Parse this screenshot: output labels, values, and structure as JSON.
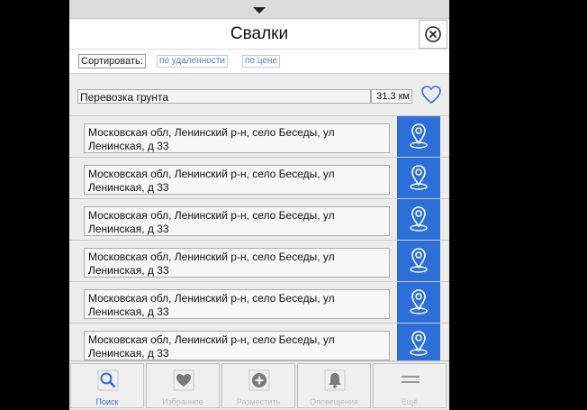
{
  "header": {
    "title": "Свалки"
  },
  "sort": {
    "label": "Сортировать:",
    "by_distance": "по удаленности",
    "by_price": "по цене"
  },
  "service": {
    "name": "Перевозка грунта",
    "distance": "31.3 км"
  },
  "dumps": [
    {
      "address": "Московская обл, Ленинский р-н, село Беседы, ул Ленинская, д 33"
    },
    {
      "address": "Московская обл, Ленинский р-н, село Беседы, ул Ленинская, д 33"
    },
    {
      "address": "Московская обл, Ленинский р-н, село Беседы, ул Ленинская, д 33"
    },
    {
      "address": "Московская обл, Ленинский р-н, село Беседы, ул Ленинская, д 33"
    },
    {
      "address": "Московская обл, Ленинский р-н, село Беседы, ул Ленинская, д 33"
    },
    {
      "address": "Московская обл, Ленинский р-н, село Беседы, ул Ленинская, д 33"
    }
  ],
  "nav": [
    {
      "label": "Поиск",
      "icon": "search-icon",
      "active": true
    },
    {
      "label": "Избранное",
      "icon": "heart-icon",
      "active": false
    },
    {
      "label": "Разместить",
      "icon": "plus-circle-icon",
      "active": false
    },
    {
      "label": "Оповещения",
      "icon": "bell-icon",
      "active": false
    },
    {
      "label": "Ещё",
      "icon": "menu-icon",
      "active": false
    }
  ],
  "colors": {
    "accent": "#2d6fd8",
    "link": "#4a7fd0",
    "background": "#ececec"
  }
}
